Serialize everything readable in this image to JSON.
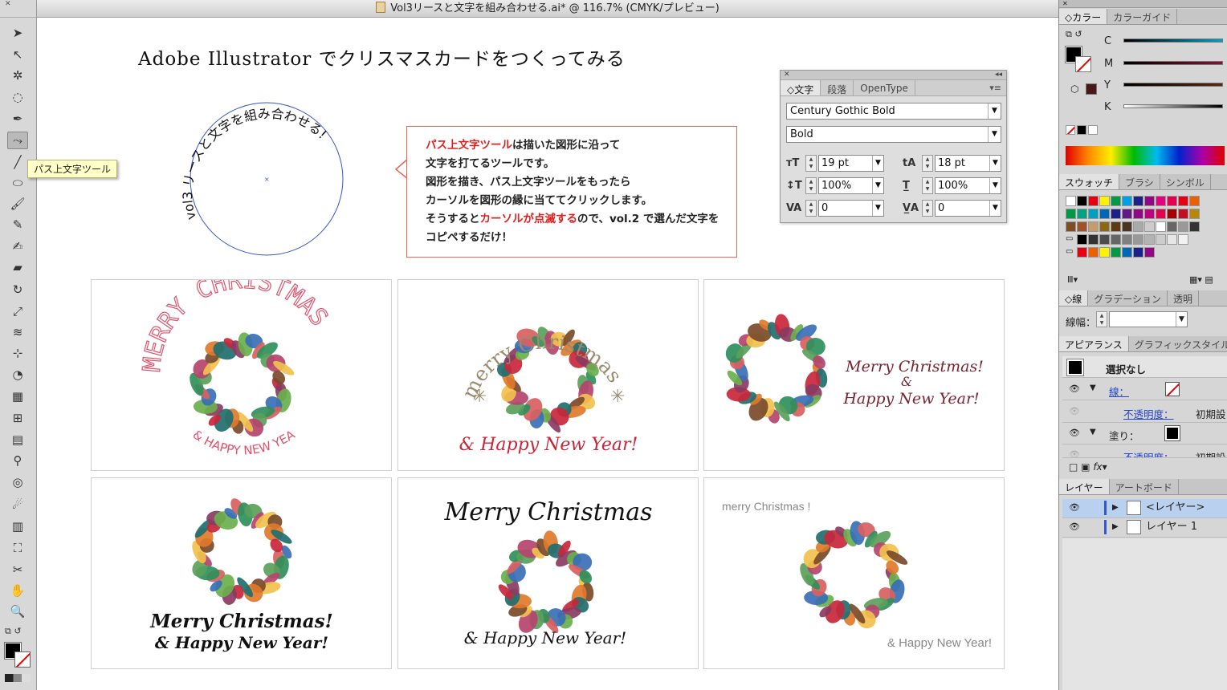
{
  "window": {
    "title": "Vol3リースと文字を組み合わせる.ai* @ 116.7% (CMYK/プレビュー)"
  },
  "toolbar": {
    "tooltip": "パス上文字ツール",
    "tools": [
      "selection-tool",
      "direct-selection-tool",
      "magic-wand-tool",
      "lasso-tool",
      "pen-tool",
      "type-on-path-tool",
      "line-tool",
      "ellipse-tool",
      "paintbrush-tool",
      "pencil-tool",
      "blob-brush-tool",
      "eraser-tool",
      "rotate-tool",
      "scale-tool",
      "warp-tool",
      "free-transform-tool",
      "shape-builder-tool",
      "perspective-grid-tool",
      "mesh-tool",
      "gradient-tool",
      "eyedropper-tool",
      "blend-tool",
      "symbol-sprayer-tool",
      "column-graph-tool",
      "artboard-tool",
      "slice-tool",
      "hand-tool",
      "zoom-tool"
    ]
  },
  "canvas": {
    "heading": "Adobe  Illustrator でクリスマスカードをつくってみる",
    "path_text": "vol3 リースと文字を組み合わせる!",
    "callout": {
      "line1_red": "パス上文字ツール",
      "line1_rest": "は描いた図形に沿って",
      "line2": "文字を打てるツールです。",
      "line3": "図形を描き、パス上文字ツールをもったら",
      "line4": "カーソルを図形の縁に当ててクリックします。",
      "line5_a": "そうすると",
      "line5_red": "カーソルが点滅する",
      "line5_b": "ので、vol.2 で選んだ文字を",
      "line6": "コピペするだけ！"
    },
    "cards": {
      "c1_top": "MERRY CHRISTMAS",
      "c1_bottom": "& HAPPY NEW YEAR",
      "c2_top": "merry Christmas",
      "c2_bottom": "& Happy New Year!",
      "c3_line1": "Merry Christmas!",
      "c3_line2": "&",
      "c3_line3": "Happy New Year!",
      "c4_line1": "Merry Christmas!",
      "c4_line2": "& Happy New Year!",
      "c5_top": "Merry Christmas",
      "c5_bottom": "& Happy New Year!",
      "c6_top": "merry Christmas !",
      "c6_bottom": "&  Happy New Year!"
    }
  },
  "char_panel": {
    "tabs": [
      "◇文字",
      "段落",
      "OpenType"
    ],
    "font_family": "Century Gothic Bold",
    "font_style": "Bold",
    "font_size": "19 pt",
    "leading": "18 pt",
    "vertical_scale": "100%",
    "horizontal_scale": "100%",
    "kerning": "0",
    "tracking": "0"
  },
  "right_panel": {
    "color_tabs": [
      "◇カラー",
      "カラーガイド"
    ],
    "cmyk_labels": [
      "C",
      "M",
      "Y",
      "K"
    ],
    "swatch_tabs": [
      "スウォッチ",
      "ブラシ",
      "シンボル"
    ],
    "stroke_tabs": [
      "◇線",
      "グラデーション",
      "透明"
    ],
    "stroke_weight_label": "線幅：",
    "appearance_tabs": [
      "アピアランス",
      "グラフィックスタイル"
    ],
    "appearance": {
      "selection": "選択なし",
      "stroke_label": "線：",
      "opacity_label": "不透明度：",
      "opacity_value": "初期設",
      "fill_label": "塗り：",
      "opacity_label2": "不透明度：",
      "opacity_value2": "初期設"
    },
    "layer_tabs": [
      "レイヤー",
      "アートボード"
    ],
    "layers": [
      "<レイヤー>",
      "レイヤー 1"
    ],
    "swatch_colors": [
      [
        "#ffffff",
        "#000000",
        "#e60012",
        "#fff100",
        "#009944",
        "#00a0e9",
        "#1d2088",
        "#920783",
        "#e4007f",
        "#e5004f",
        "#e60012",
        "#eb6100"
      ],
      [
        "#009944",
        "#00a381",
        "#00a0c1",
        "#0068b7",
        "#1d2088",
        "#601986",
        "#920783",
        "#be0081",
        "#e5004f",
        "#a40000",
        "#c30d23",
        "#b8860b"
      ],
      [
        "#7d4e24",
        "#a0522d",
        "#c69c6d",
        "#8b6914",
        "#603813",
        "#4d3321",
        "#aaaaaa",
        "#cccccc",
        "#ffffff",
        "#666666",
        "#999999",
        "#333333"
      ],
      [
        "#000000",
        "#333333",
        "#4d4d4d",
        "#666666",
        "#808080",
        "#999999",
        "#b3b3b3",
        "#cccccc",
        "#e6e6e6",
        "#f2f2f2"
      ],
      [
        "#e60012",
        "#eb6100",
        "#fff100",
        "#009944",
        "#0068b7",
        "#1d2088",
        "#920783"
      ]
    ]
  }
}
